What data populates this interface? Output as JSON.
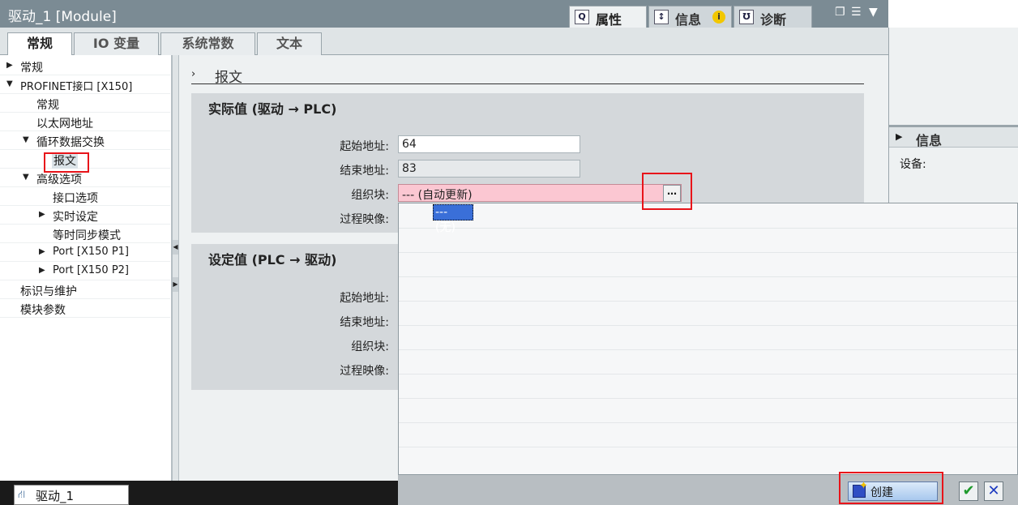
{
  "window": {
    "title": "驱动_1 [Module]"
  },
  "panel_tabs": [
    {
      "label": "属性",
      "icon": "properties-icon"
    },
    {
      "label": "信息",
      "icon": "info-icon"
    },
    {
      "label": "诊断",
      "icon": "diagnostics-icon"
    }
  ],
  "tabs": [
    "常规",
    "IO 变量",
    "系统常数",
    "文本"
  ],
  "nav": [
    {
      "label": "常规",
      "arrow": "▶"
    },
    {
      "label": "PROFINET接口 [X150]",
      "arrow": "▼"
    },
    {
      "label": "常规",
      "arrow": ""
    },
    {
      "label": "以太网地址",
      "arrow": ""
    },
    {
      "label": "循环数据交换",
      "arrow": "▼"
    },
    {
      "label": "报文",
      "arrow": ""
    },
    {
      "label": "高级选项",
      "arrow": "▼"
    },
    {
      "label": "接口选项",
      "arrow": ""
    },
    {
      "label": "实时设定",
      "arrow": "▶"
    },
    {
      "label": "等时同步模式",
      "arrow": ""
    },
    {
      "label": "Port [X150 P1]",
      "arrow": "▶"
    },
    {
      "label": "Port [X150 P2]",
      "arrow": "▶"
    },
    {
      "label": "标识与维护",
      "arrow": ""
    },
    {
      "label": "模块参数",
      "arrow": ""
    }
  ],
  "section": {
    "chevron": "›",
    "title": "报文"
  },
  "actual": {
    "title": "实际值 (驱动 → PLC)",
    "start_label": "起始地址:",
    "start_value": "64",
    "end_label": "结束地址:",
    "end_value": "83",
    "ob_label": "组织块:",
    "ob_value": "--- (自动更新)",
    "pi_label": "过程映像:"
  },
  "setpoint": {
    "title": "设定值 (PLC → 驱动)",
    "start_label": "起始地址:",
    "end_label": "结束地址:",
    "ob_label": "组织块:",
    "pi_label": "过程映像:"
  },
  "dropdown": {
    "selected": "--- (无)",
    "create_label": "创建"
  },
  "info_panel": {
    "title": "信息",
    "device_label": "设备:"
  },
  "taskbar": {
    "item_label": "驱动_1"
  }
}
